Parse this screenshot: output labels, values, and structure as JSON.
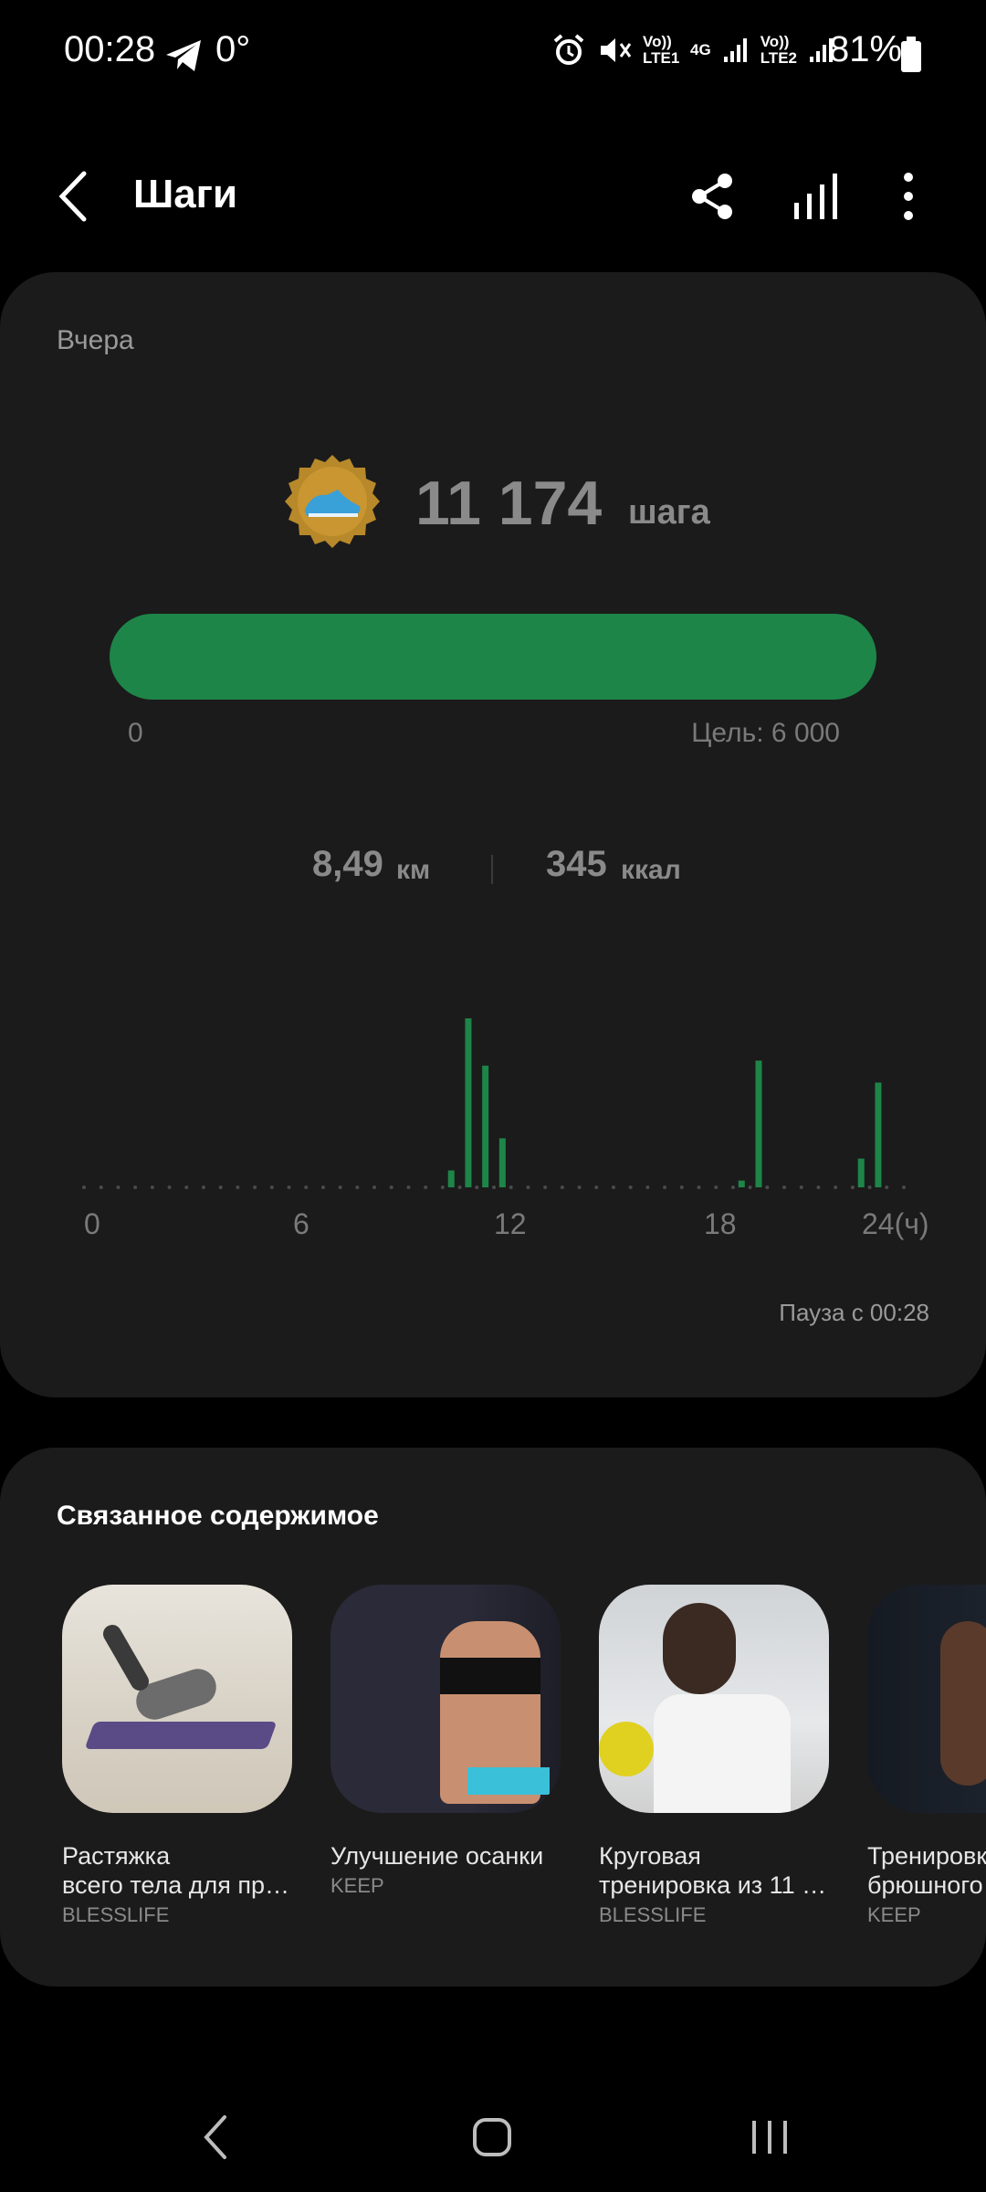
{
  "status_bar": {
    "time": "00:28",
    "temperature": "0°",
    "battery": "81%",
    "icons": [
      "telegram-icon",
      "alarm-icon",
      "mute-icon",
      "volte-lte1",
      "4g-icon",
      "signal-icon",
      "volte-lte2",
      "signal-icon",
      "battery-icon"
    ],
    "net_labels": [
      "Vo)) LTE1",
      "4G",
      "Vo)) LTE2"
    ]
  },
  "app_bar": {
    "title": "Шаги",
    "icons": [
      "back-icon",
      "share-icon",
      "chart-icon",
      "more-icon"
    ]
  },
  "steps_card": {
    "date": "Вчера",
    "steps_value": "11 174",
    "steps_unit": "шага",
    "progress_min": "0",
    "goal_label": "Цель: 6 000",
    "progress_fraction": 1.0,
    "distance_value": "8,49",
    "distance_unit": "км",
    "calories_value": "345",
    "calories_unit": "ккал",
    "pause_label": "Пауза с 00:28",
    "colors": {
      "accent": "#1e8549",
      "card": "#1b1b1b"
    }
  },
  "chart_data": {
    "type": "bar",
    "x_ticks": [
      "0",
      "6",
      "12",
      "18",
      "24(ч)"
    ],
    "xlim": [
      0,
      24
    ],
    "bars": [
      {
        "hour": 10.75,
        "value": 10
      },
      {
        "hour": 11.25,
        "value": 100
      },
      {
        "hour": 11.75,
        "value": 72
      },
      {
        "hour": 12.25,
        "value": 29
      },
      {
        "hour": 19.25,
        "value": 4
      },
      {
        "hour": 19.75,
        "value": 75
      },
      {
        "hour": 22.75,
        "value": 17
      },
      {
        "hour": 23.25,
        "value": 62
      }
    ],
    "grid": false
  },
  "related": {
    "title": "Связанное содержимое",
    "items": [
      {
        "title": "Растяжка\nвсего тела для пр…",
        "source": "BLESSLIFE",
        "image": "stretch-photo"
      },
      {
        "title": "Улучшение осанки",
        "source": "KEEP",
        "image": "posture-photo"
      },
      {
        "title": "Круговая\nтренировка из 11 …",
        "source": "BLESSLIFE",
        "image": "circuit-photo"
      },
      {
        "title": "Тренировк\nбрюшного",
        "source": "KEEP",
        "image": "abs-photo"
      }
    ]
  }
}
